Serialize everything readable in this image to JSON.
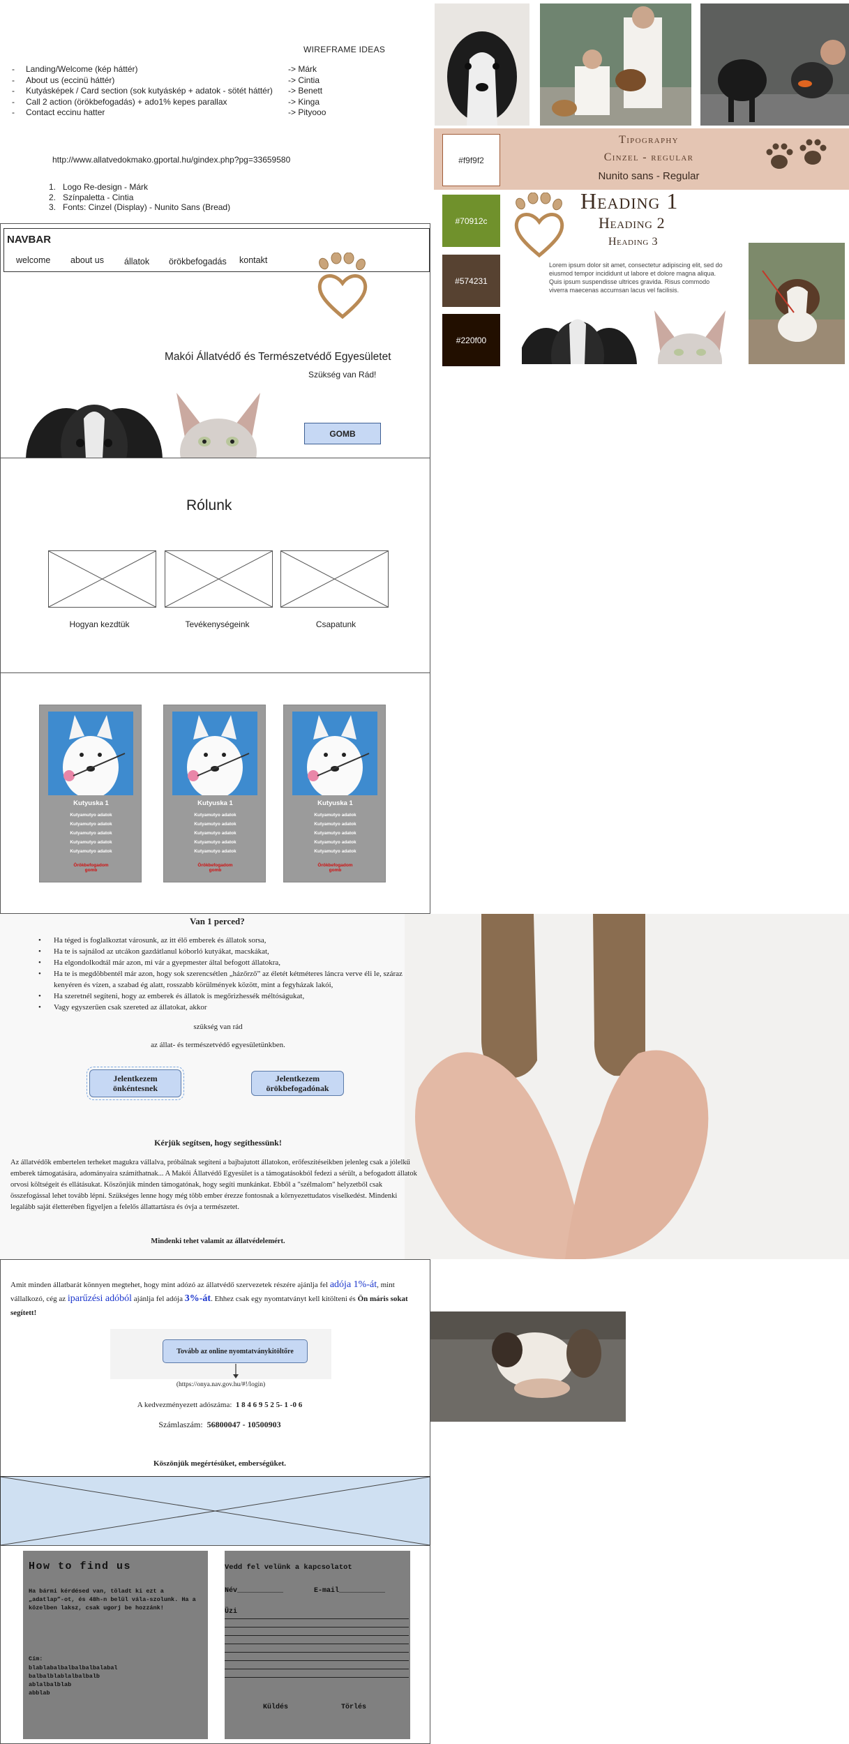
{
  "notes": {
    "title": "WIREFRAME IDEAS",
    "sections": [
      {
        "label": "Landing/Welcome (kép háttér)",
        "owner": "-> Márk"
      },
      {
        "label": "About us (eccinü háttér)",
        "owner": "-> Cintia"
      },
      {
        "label": "Kutyásképek / Card section (sok kutyáskép + adatok - sötét háttér)",
        "owner": "-> Benett"
      },
      {
        "label": "Call 2 action (örökbefogadás) + ado1% kepes parallax",
        "owner": "-> Kinga"
      },
      {
        "label": "Contact eccinu hatter",
        "owner": "-> Pityooo"
      }
    ],
    "dash": "-",
    "link": "http://www.allatvedokmako.gportal.hu/gindex.php?pg=33659580",
    "tasks": [
      {
        "num": "1.",
        "text": "Logo Re-design - Márk"
      },
      {
        "num": "2.",
        "text": "Színpaletta - Cintia"
      },
      {
        "num": "3.",
        "text": "Fonts: Cinzel (Display) - Nunito Sans (Bread)"
      }
    ]
  },
  "navbar": {
    "title": "NAVBAR",
    "items": [
      "welcome",
      "about us",
      "állatok",
      "örökbefogadás",
      "kontakt"
    ]
  },
  "hero": {
    "title": "Makói Állatvédő és Természetvédő Egyesületet",
    "subtitle": "Szükség van Rád!",
    "button": "GOMB"
  },
  "about": {
    "title": "Rólunk",
    "captions": [
      "Hogyan kezdtük",
      "Tevékenységeink",
      "Csapatunk"
    ]
  },
  "cards": {
    "name": "Kutyuska 1",
    "line": "Kutyamutyo adatok",
    "button": "Örökbefogadom gomb"
  },
  "mission": {
    "title": "Van 1 perced?",
    "bullets": [
      "Ha téged is foglalkoztat városunk, az itt élő emberek és állatok sorsa,",
      "Ha te is sajnálod az utcákon gazdátlanul kóborló kutyákat, macskákat,",
      "Ha elgondolkodtál már azon, mi vár a gyepmester által befogott állatokra,",
      "Ha te is megdöbbentél már azon, hogy sok szerencsétlen „házőrző” az életét kétméteres láncra verve éli le, száraz kenyéren és vízen, a szabad ég alatt, rosszabb körülmények között, mint a fegyházak lakói,",
      "Ha szeretnél segíteni, hogy az emberek és állatok is megőrizhessék méltóságukat,",
      "Vagy egyszerűen csak szereted az állatokat, akkor"
    ],
    "line1": "szükség van rád",
    "line2": "az állat- és természetvédő egyesületünkben.",
    "btn_volunteer": "Jelentkezem önkéntesnek",
    "btn_adopt": "Jelentkezem örökbefogadónak",
    "help_title": "Kérjük segítsen, hogy segíthessünk!",
    "paragraph": "Az állatvédők embertelen terheket magukra vállalva, próbálnak segíteni a bajbajutott állatokon, erőfeszítéseikben jelenleg csak a jólelkű emberek támogatására, adományaira számíthatnak... A Makói Állatvédő Egyesület is a támogatásokból fedezi a sérült, a befogadott állatok orvosi költségeit és ellátásukat.  Köszönjük minden támogatónak, hogy segíti munkánkat. Ebből a \"szélmalom\" helyzetből csak összefogással lehet tovább lépni. Szükséges lenne hogy még több ember érezze fontosnak a környezettudatos viselkedést. Mindenki legalább  saját életterében  figyeljen a felelős állattartásra és óvja a természetet.",
    "closing": "Mindenki tehet valamit az állatvédelemért."
  },
  "tax": {
    "text_a": "Amit minden állatbarát könnyen megtehet, hogy mint adózó az állatvédő szervezetek részére ajánlja fel ",
    "hl_1": "adója 1%-át",
    "text_b": ", mint vállalkozó, cég az ",
    "hl_2": "iparűzési adóból",
    "text_c": " ajánlja fel adója ",
    "hl_3": "3%-át",
    "text_d": ". Ehhez csak egy nyomtatványt kell kitölteni és ",
    "text_e": "Ön máris sokat segített!",
    "online_button": "Tovább az online nyomtatványkitöltőre",
    "online_url": "(https://onya.nav.gov.hu/#!/login)",
    "tax_label": "A kedvezményezett adószáma:",
    "tax_number": "1 8 4 6 9 5 2 5- 1 -0 6",
    "account_label": "Számlaszám:",
    "account_number": "56800047 - 10500903",
    "thanks": "Köszönjük megértésüket, emberségüket."
  },
  "footer": {
    "find_title": "How to find us",
    "find_text": "Ha bármi kérdésed van, töladt ki ezt a „adatlap”-ot, és 48h-n belül vála-szolunk. Ha a közelben laksz, csak ugorj be hozzánk!",
    "addr_label": "Cím:",
    "addr_lines": [
      "blablabalbalbalbalbalabal",
      "balbalblablalbalbalb",
      "ablalbalblab",
      "abblab"
    ],
    "contact_title": "Vedd fel velünk a kapcsolatot",
    "name_label": "Név___________",
    "email_label": "E-mail___________",
    "msg_label": "Üzi",
    "send": "Küldés",
    "clear": "Törlés"
  },
  "style_guide": {
    "tipo_title": "Tipography",
    "tipo_cinzel": "Cinzel - regular",
    "tipo_nunito": "Nunito sans - Regular",
    "swatches": [
      {
        "hex": "#f9f9f2",
        "color": "#f9f9f2"
      },
      {
        "hex": "#70912c",
        "color": "#70912c"
      },
      {
        "hex": "#574231",
        "color": "#574231"
      },
      {
        "hex": "#220f00",
        "color": "#220f00"
      }
    ],
    "heading1": "Heading 1",
    "heading2": "Heading 2",
    "heading3": "Heading 3",
    "lorem": "Lorem ipsum dolor sit amet, consectetur adipiscing elit, sed do eiusmod tempor incididunt ut labore et dolore magna aliqua. Quis ipsum suspendisse ultrices gravida. Risus commodo viverra maecenas accumsan lacus vel facilisis."
  }
}
